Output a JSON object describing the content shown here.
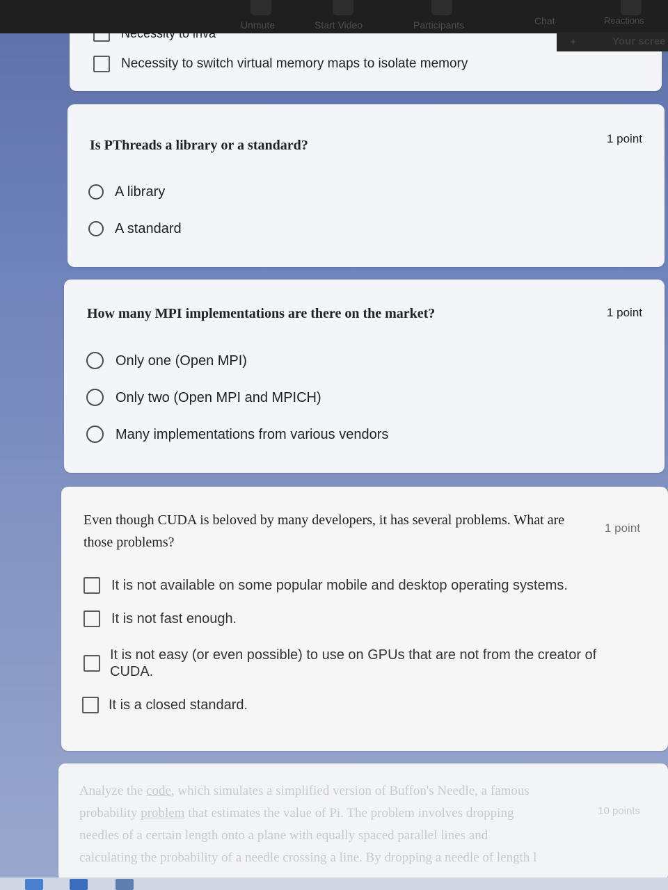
{
  "zoom": {
    "controls": [
      "Unmute",
      "Start Video",
      "Participants",
      "Chat",
      "Reactions"
    ],
    "share_label": "Your scree",
    "colors": {
      "bar": "#1f1f1f",
      "text": "#4d4d4d"
    }
  },
  "card1": {
    "options": [
      {
        "label": "Necessity to inva",
        "type": "checkbox"
      },
      {
        "label": "Necessity to switch virtual memory maps to isolate memory",
        "type": "checkbox"
      }
    ]
  },
  "q_pthreads": {
    "title": "Is PThreads a library or a standard?",
    "points": "1 point",
    "options": [
      {
        "label": "A library"
      },
      {
        "label": "A standard"
      }
    ]
  },
  "q_mpi": {
    "title": "How many MPI implementations are there on the market?",
    "points": "1 point",
    "options": [
      {
        "label": "Only one (Open MPI)"
      },
      {
        "label": "Only two (Open MPI and MPICH)"
      },
      {
        "label": "Many implementations from various vendors"
      }
    ]
  },
  "q_cuda": {
    "title_line1": "Even though CUDA is beloved by many developers, it has several problems. What are",
    "title_line2": "those problems?",
    "points": "1 point",
    "options": [
      {
        "label": "It is not available on some popular mobile and desktop operating systems."
      },
      {
        "label": "It is not fast enough."
      },
      {
        "label_line1": "It is not easy (or even possible) to use on GPUs that are not from the creator of",
        "label_line2": "CUDA."
      },
      {
        "label": "It is a closed standard."
      }
    ]
  },
  "q_buffon": {
    "line1_pre": "Analyze the ",
    "line1_link": "code",
    "line1_post": ", which simulates a simplified version of Buffon's Needle, a famous",
    "line2_pre": "probability ",
    "line2_link": "problem",
    "line2_post": " that estimates the value of Pi. The problem involves dropping",
    "line3": "needles of a certain length onto a plane with equally spaced parallel lines and",
    "line4": "calculating the probability of a needle crossing a line. By dropping a needle of length l",
    "points": "10 points"
  },
  "colors": {
    "background": "#6f83bb",
    "card": "#f4f5f8",
    "text": "#202124"
  }
}
